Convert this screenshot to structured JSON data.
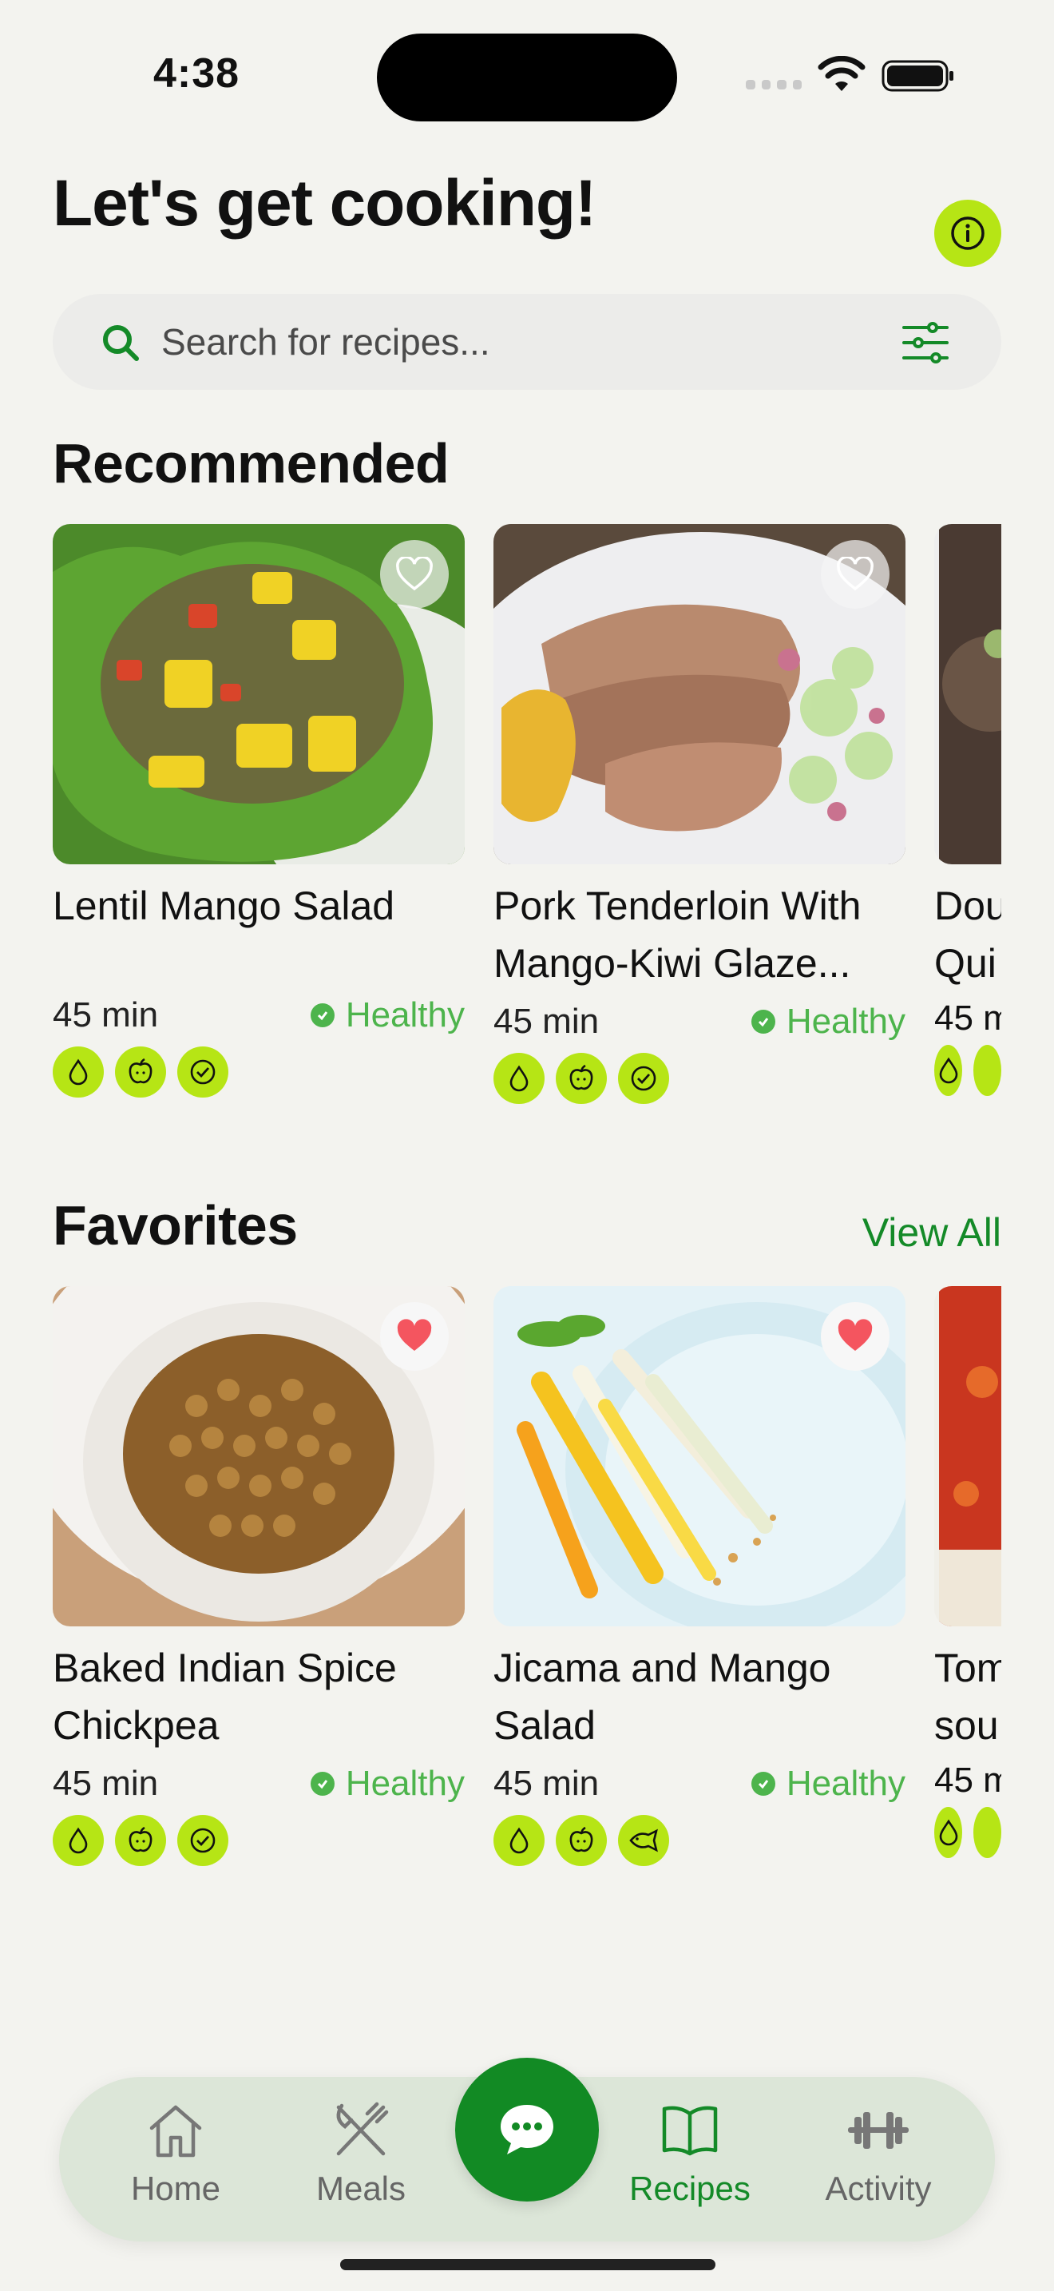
{
  "status_bar": {
    "time": "4:38"
  },
  "header": {
    "title": "Let's get cooking!"
  },
  "search": {
    "placeholder": "Search for recipes..."
  },
  "recommended": {
    "title": "Recommended",
    "cards": [
      {
        "title": "Lentil Mango Salad",
        "time": "45 min",
        "tag": "Healthy",
        "favorite": false,
        "badges": [
          "drop-icon",
          "apple-icon",
          "check-icon"
        ]
      },
      {
        "title": "Pork Tenderloin With Mango-Kiwi Glaze...",
        "time": "45 min",
        "tag": "Healthy",
        "favorite": false,
        "badges": [
          "drop-icon",
          "apple-icon",
          "check-icon"
        ]
      }
    ],
    "peek": {
      "title_line1": "Dou",
      "title_line2": "Qui",
      "time": "45 m"
    }
  },
  "favorites": {
    "title": "Favorites",
    "view_all": "View All",
    "cards": [
      {
        "title": "Baked Indian Spice Chickpea",
        "time": "45 min",
        "tag": "Healthy",
        "favorite": true,
        "badges": [
          "drop-icon",
          "apple-icon",
          "check-icon"
        ]
      },
      {
        "title": "Jicama and Mango Salad",
        "time": "45 min",
        "tag": "Healthy",
        "favorite": true,
        "badges": [
          "drop-icon",
          "apple-icon",
          "fish-icon"
        ]
      }
    ],
    "peek": {
      "title_line1": "Tom",
      "title_line2": "sou",
      "time": "45 m"
    }
  },
  "tabbar": {
    "tabs": [
      {
        "label": "Home",
        "icon": "home-icon"
      },
      {
        "label": "Meals",
        "icon": "fork-knife-icon"
      },
      {
        "label": "Recipes",
        "icon": "book-icon",
        "active": true
      },
      {
        "label": "Activity",
        "icon": "dumbbell-icon"
      }
    ],
    "center": {
      "icon": "chat-icon"
    }
  },
  "colors": {
    "accent": "#148a28",
    "lime": "#b6e515",
    "healthy": "#4db44c",
    "heart": "#f4555f",
    "background": "#f3f3ef"
  }
}
